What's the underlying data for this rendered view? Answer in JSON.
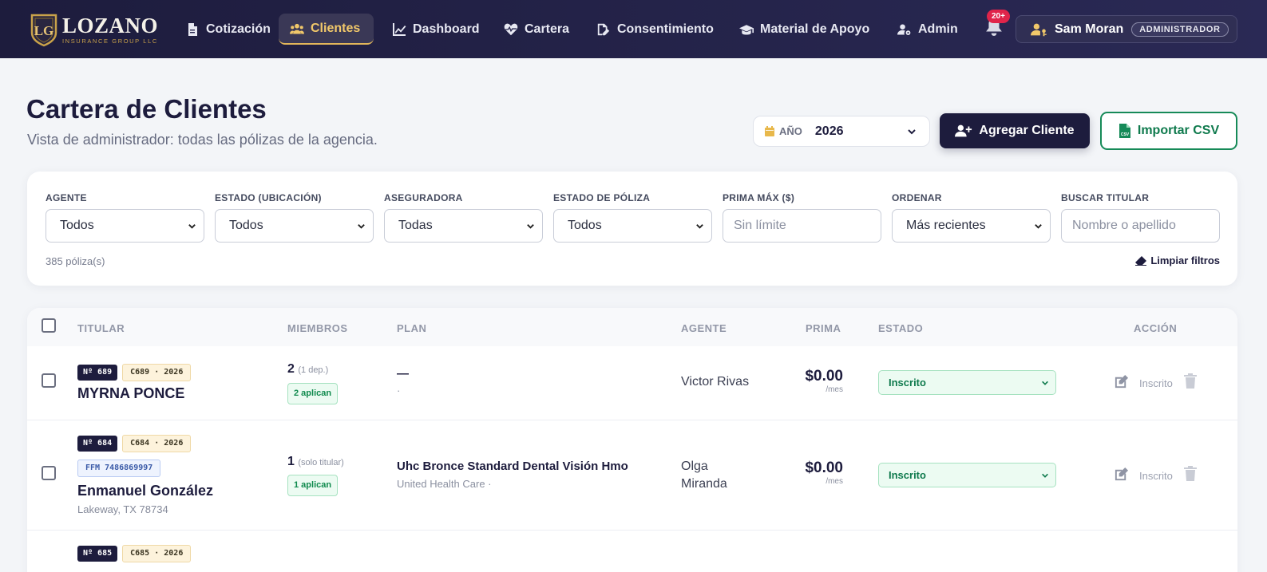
{
  "brand": {
    "name": "LOZANO",
    "subtitle": "INSURANCE GROUP LLC",
    "monogram": "LG"
  },
  "nav": [
    {
      "label": "Cotización",
      "icon": "document-icon",
      "active": false
    },
    {
      "label": "Clientes",
      "icon": "users-icon",
      "active": true
    },
    {
      "label": "Dashboard",
      "icon": "line-chart-icon",
      "active": false
    },
    {
      "label": "Cartera",
      "icon": "heart-pulse-icon",
      "active": false
    },
    {
      "label": "Consentimiento",
      "icon": "signature-icon",
      "active": false
    },
    {
      "label": "Material de Apoyo",
      "icon": "graduation-cap-icon",
      "active": false
    },
    {
      "label": "Admin",
      "icon": "user-gear-icon",
      "active": false
    }
  ],
  "notifications": {
    "badge": "20+",
    "icon": "bell-icon"
  },
  "user": {
    "name": "Sam Moran",
    "role": "ADMINISTRADOR",
    "icon": "user-key-icon"
  },
  "header": {
    "title": "Cartera de Clientes",
    "subtitle": "Vista de administrador: todas las pólizas de la agencia.",
    "year_label": "AÑO",
    "year_value": "2026",
    "add_button": "Agregar Cliente",
    "import_button": "Importar CSV"
  },
  "filters": {
    "agent": {
      "label": "AGENTE",
      "value": "Todos"
    },
    "state": {
      "label": "ESTADO (UBICACIÓN)",
      "value": "Todos"
    },
    "insurer": {
      "label": "ASEGURADORA",
      "value": "Todas"
    },
    "policy_status": {
      "label": "ESTADO DE PÓLIZA",
      "value": "Todos"
    },
    "max_premium": {
      "label": "PRIMA MÁX ($)",
      "placeholder": "Sin límite"
    },
    "sort": {
      "label": "ORDENAR",
      "value": "Más recientes"
    },
    "search": {
      "label": "BUSCAR TITULAR",
      "placeholder": "Nombre o apellido"
    },
    "count": "385 póliza(s)",
    "clear": "Limpiar filtros"
  },
  "table": {
    "columns": [
      "TITULAR",
      "MIEMBROS",
      "PLAN",
      "AGENTE",
      "PRIMA",
      "ESTADO",
      "ACCIÓN"
    ],
    "rows": [
      {
        "num": "Nº 689",
        "code": "C689 · 2026",
        "ffm": "",
        "name": "MYRNA PONCE",
        "location": "",
        "members": "2",
        "members_note": "(1 dep.)",
        "apply": "2 aplican",
        "plan": "—",
        "plan_sub": "·",
        "agent": "Victor Rivas",
        "premium": "$0.00",
        "per": "/mes",
        "status": "Inscrito",
        "action_text": "Inscrito"
      },
      {
        "num": "Nº 684",
        "code": "C684 · 2026",
        "ffm": "FFM 7486869997",
        "name": "Enmanuel González",
        "location": "Lakeway, TX 78734",
        "members": "1",
        "members_note": "(solo titular)",
        "apply": "1 aplican",
        "plan": "Uhc Bronce Standard Dental Visión Hmo",
        "plan_sub": "United Health Care ·",
        "agent": "Olga Miranda",
        "premium": "$0.00",
        "per": "/mes",
        "status": "Inscrito",
        "action_text": "Inscrito"
      },
      {
        "num": "Nº 685",
        "code": "C685 · 2026"
      }
    ]
  },
  "colors": {
    "navy": "#1d1c3d",
    "gold": "#f1c86a",
    "green": "#0f7a4d",
    "badge_red": "#e0244a"
  }
}
